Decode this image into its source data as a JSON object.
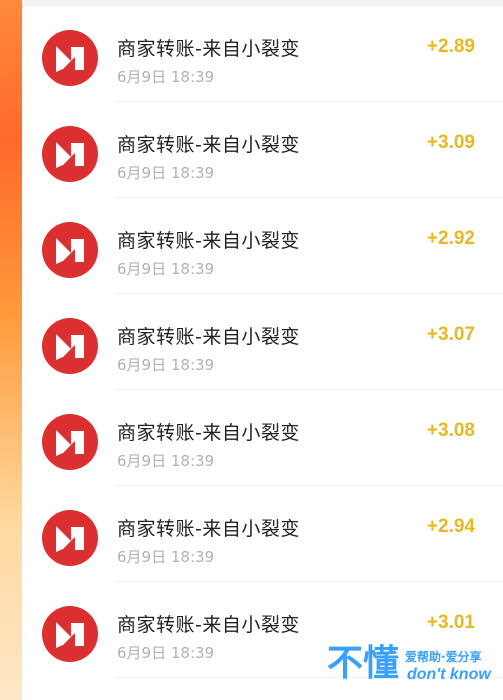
{
  "transactions": [
    {
      "title": "商家转账-来自小裂变",
      "time": "6月9日 18:39",
      "amount": "+2.89"
    },
    {
      "title": "商家转账-来自小裂变",
      "time": "6月9日 18:39",
      "amount": "+3.09"
    },
    {
      "title": "商家转账-来自小裂变",
      "time": "6月9日 18:39",
      "amount": "+2.92"
    },
    {
      "title": "商家转账-来自小裂变",
      "time": "6月9日 18:39",
      "amount": "+3.07"
    },
    {
      "title": "商家转账-来自小裂变",
      "time": "6月9日 18:39",
      "amount": "+3.08"
    },
    {
      "title": "商家转账-来自小裂变",
      "time": "6月9日 18:39",
      "amount": "+2.94"
    },
    {
      "title": "商家转账-来自小裂变",
      "time": "6月9日 18:39",
      "amount": "+3.01"
    }
  ],
  "icon": "merchant-logo-icon",
  "colors": {
    "amount": "#e8b820",
    "logo": "#dc2f2f",
    "title": "#222222",
    "time": "#b0b0b0"
  },
  "watermark": {
    "big": "不懂",
    "line1": "爱帮助·爱分享",
    "line2": "don't know"
  }
}
